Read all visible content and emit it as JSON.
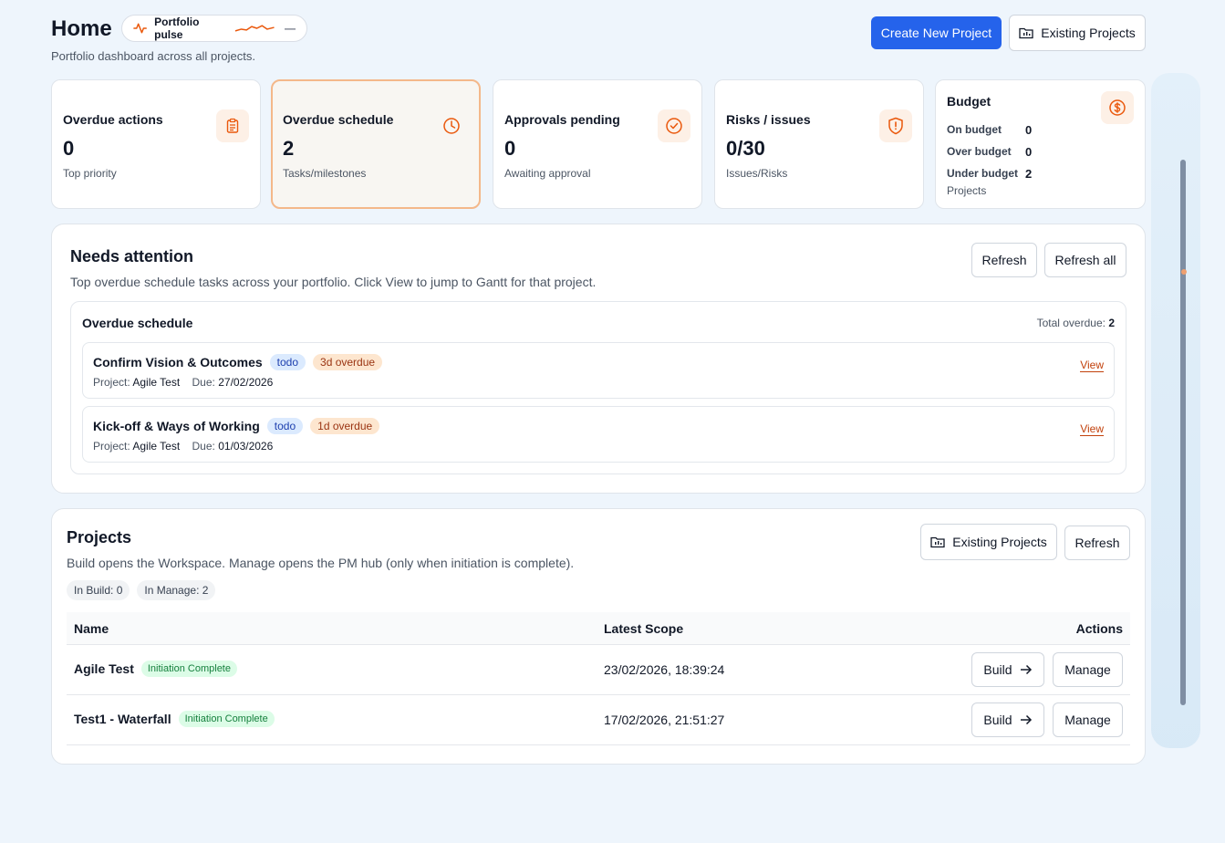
{
  "header": {
    "title": "Home",
    "pulse_label": "Portfolio pulse",
    "pulse_value": "—",
    "subtitle": "Portfolio dashboard across all projects.",
    "create_label": "Create New Project",
    "existing_label": "Existing Projects"
  },
  "kpis": {
    "overdue_actions": {
      "label": "Overdue actions",
      "value": "0",
      "sub": "Top priority",
      "icon": "clipboard-icon"
    },
    "overdue_schedule": {
      "label": "Overdue schedule",
      "value": "2",
      "sub": "Tasks/milestones",
      "icon": "clock-icon"
    },
    "approvals": {
      "label": "Approvals pending",
      "value": "0",
      "sub": "Awaiting approval",
      "icon": "check-circle-icon"
    },
    "risks": {
      "label": "Risks / issues",
      "value": "0/30",
      "sub": "Issues/Risks",
      "icon": "shield-alert-icon"
    },
    "budget": {
      "label": "Budget",
      "rows": [
        {
          "k": "On budget",
          "v": "0"
        },
        {
          "k": "Over budget",
          "v": "0"
        },
        {
          "k": "Under budget",
          "v": "2"
        }
      ],
      "sub": "Projects",
      "icon": "dollar-circle-icon"
    }
  },
  "attention": {
    "title": "Needs attention",
    "desc": "Top overdue schedule tasks across your portfolio. Click View to jump to Gantt for that project.",
    "refresh_label": "Refresh",
    "refresh_all_label": "Refresh all",
    "inner_title": "Overdue schedule",
    "total_label": "Total overdue:",
    "total_value": "2",
    "tasks": [
      {
        "name": "Confirm Vision & Outcomes",
        "status": "todo",
        "overdue": "3d overdue",
        "project_label": "Project:",
        "project": "Agile Test",
        "due_label": "Due:",
        "due": "27/02/2026",
        "view": "View"
      },
      {
        "name": "Kick-off & Ways of Working",
        "status": "todo",
        "overdue": "1d overdue",
        "project_label": "Project:",
        "project": "Agile Test",
        "due_label": "Due:",
        "due": "01/03/2026",
        "view": "View"
      }
    ]
  },
  "projects": {
    "title": "Projects",
    "desc": "Build opens the Workspace. Manage opens the PM hub (only when initiation is complete).",
    "existing_label": "Existing Projects",
    "refresh_label": "Refresh",
    "chips": [
      "In Build: 0",
      "In Manage: 2"
    ],
    "columns": {
      "name": "Name",
      "scope": "Latest Scope",
      "actions": "Actions"
    },
    "rows": [
      {
        "name": "Agile Test",
        "badge": "Initiation Complete",
        "scope": "23/02/2026, 18:39:24",
        "build": "Build",
        "manage": "Manage"
      },
      {
        "name": "Test1 - Waterfall",
        "badge": "Initiation Complete",
        "scope": "17/02/2026, 21:51:27",
        "build": "Build",
        "manage": "Manage"
      }
    ]
  },
  "colors": {
    "accent": "#2563eb",
    "orange": "#ea580c",
    "active_border": "#f4b88a"
  }
}
